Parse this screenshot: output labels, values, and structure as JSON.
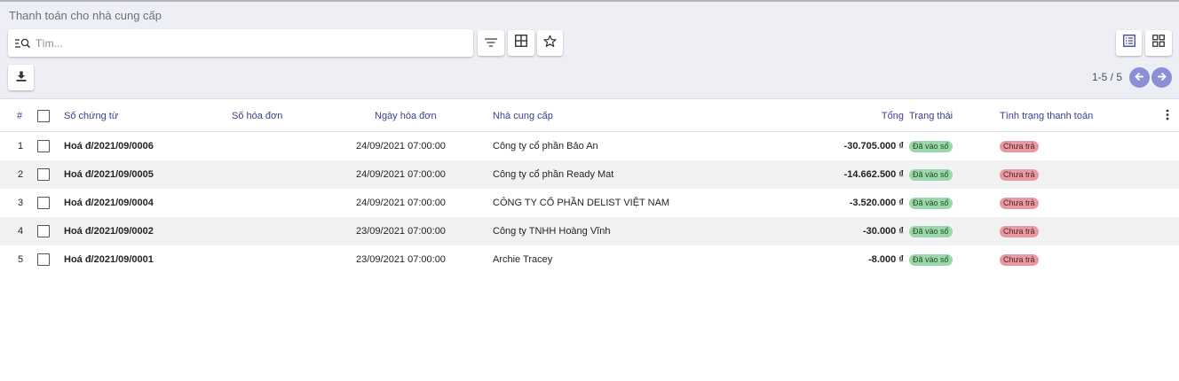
{
  "breadcrumb": "Thanh toán cho nhà cung cấp",
  "search": {
    "placeholder": "Tìm..."
  },
  "toolbar": {
    "filter_icon": "filter-icon",
    "groupby_icon": "grid-icon",
    "favorite_icon": "star-icon",
    "download_icon": "download-icon",
    "list_view_icon": "list-view-icon",
    "kanban_view_icon": "kanban-view-icon"
  },
  "pager": {
    "text": "1-5 / 5"
  },
  "table": {
    "columns": {
      "num": "#",
      "doc_no": "Số chứng từ",
      "invoice_no": "Số hóa đơn",
      "invoice_date": "Ngày hóa đơn",
      "vendor": "Nhà cung cấp",
      "total": "Tổng",
      "status": "Trạng thái",
      "payment_status": "Tình trạng thanh toán"
    },
    "rows": [
      {
        "num": "1",
        "doc_no": "Hoá đ/2021/09/0006",
        "invoice_no": "",
        "invoice_date": "24/09/2021 07:00:00",
        "vendor": "Công ty cổ phần Bảo An",
        "total": "-30.705.000 ₫",
        "status": "Đã vào sổ",
        "payment_status": "Chưa trả"
      },
      {
        "num": "2",
        "doc_no": "Hoá đ/2021/09/0005",
        "invoice_no": "",
        "invoice_date": "24/09/2021 07:00:00",
        "vendor": "Công ty cổ phần Ready Mat",
        "total": "-14.662.500 ₫",
        "status": "Đã vào sổ",
        "payment_status": "Chưa trả"
      },
      {
        "num": "3",
        "doc_no": "Hoá đ/2021/09/0004",
        "invoice_no": "",
        "invoice_date": "24/09/2021 07:00:00",
        "vendor": "CÔNG TY CỔ PHẦN DELIST VIỆT NAM",
        "total": "-3.520.000 ₫",
        "status": "Đã vào sổ",
        "payment_status": "Chưa trả"
      },
      {
        "num": "4",
        "doc_no": "Hoá đ/2021/09/0002",
        "invoice_no": "",
        "invoice_date": "23/09/2021 07:00:00",
        "vendor": "Công ty TNHH Hoàng Vĩnh",
        "total": "-30.000 ₫",
        "status": "Đã vào sổ",
        "payment_status": "Chưa trả"
      },
      {
        "num": "5",
        "doc_no": "Hoá đ/2021/09/0001",
        "invoice_no": "",
        "invoice_date": "23/09/2021 07:00:00",
        "vendor": "Archie Tracey",
        "total": "-8.000 ₫",
        "status": "Đã vào sổ",
        "payment_status": "Chưa trả"
      }
    ]
  },
  "colors": {
    "header_text": "#3b3f8e",
    "pager_button": "#8a8fd6",
    "status_green": "#9bd7a9",
    "status_red": "#e79aa3"
  }
}
